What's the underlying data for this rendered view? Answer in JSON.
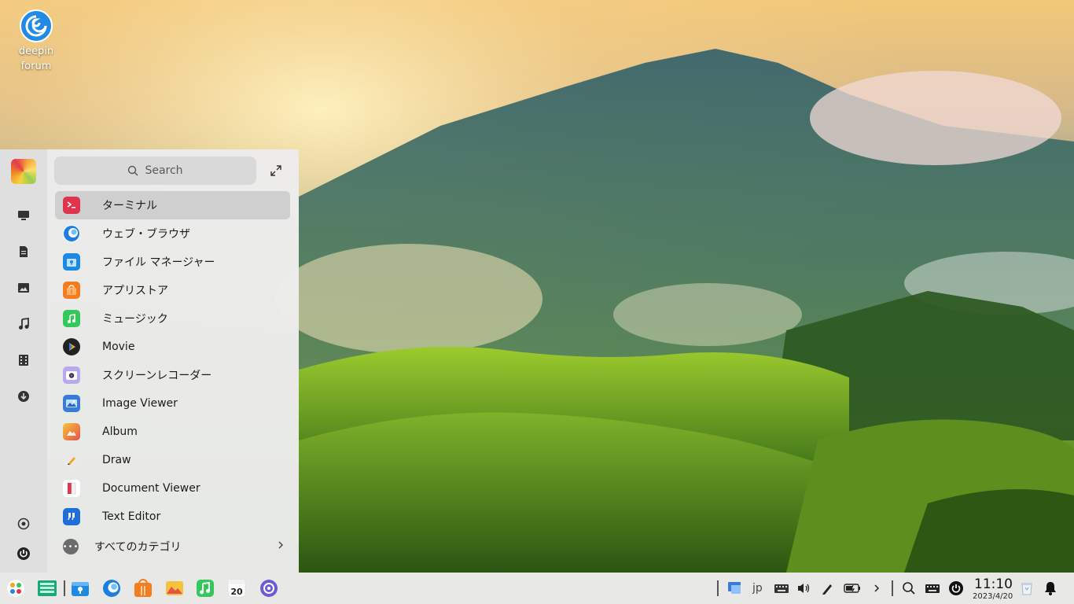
{
  "desktop": {
    "icon_label_line1": "deepin",
    "icon_label_line2": "forum"
  },
  "launcher": {
    "search_placeholder": "Search",
    "apps": [
      {
        "label": "ターミナル",
        "icon": "terminal-icon",
        "color": "#e0334d"
      },
      {
        "label": "ウェブ・ブラウザ",
        "icon": "browser-icon",
        "color": "#1a7fe0"
      },
      {
        "label": "ファイル マネージャー",
        "icon": "file-manager-icon",
        "color": "#1e88e5"
      },
      {
        "label": "アプリストア",
        "icon": "app-store-icon",
        "color": "#f57c1f"
      },
      {
        "label": "ミュージック",
        "icon": "music-icon",
        "color": "#34c759"
      },
      {
        "label": "Movie",
        "icon": "movie-icon",
        "color": "#222222"
      },
      {
        "label": "スクリーンレコーダー",
        "icon": "screen-recorder-icon",
        "color": "#7b5cd6"
      },
      {
        "label": "Image Viewer",
        "icon": "image-viewer-icon",
        "color": "#3a7bd5"
      },
      {
        "label": "Album",
        "icon": "album-icon",
        "color": "#f08a2a"
      },
      {
        "label": "Draw",
        "icon": "draw-icon",
        "color": "#e9e9e9"
      },
      {
        "label": "Document Viewer",
        "icon": "document-viewer-icon",
        "color": "#e0334d"
      },
      {
        "label": "Text Editor",
        "icon": "text-editor-icon",
        "color": "#1e6fd9"
      }
    ],
    "all_categories_label": "すべてのカテゴリ"
  },
  "taskbar": {
    "input_method": "jp",
    "calendar_day": "20",
    "clock_time": "11:10",
    "clock_date": "2023/4/20"
  }
}
